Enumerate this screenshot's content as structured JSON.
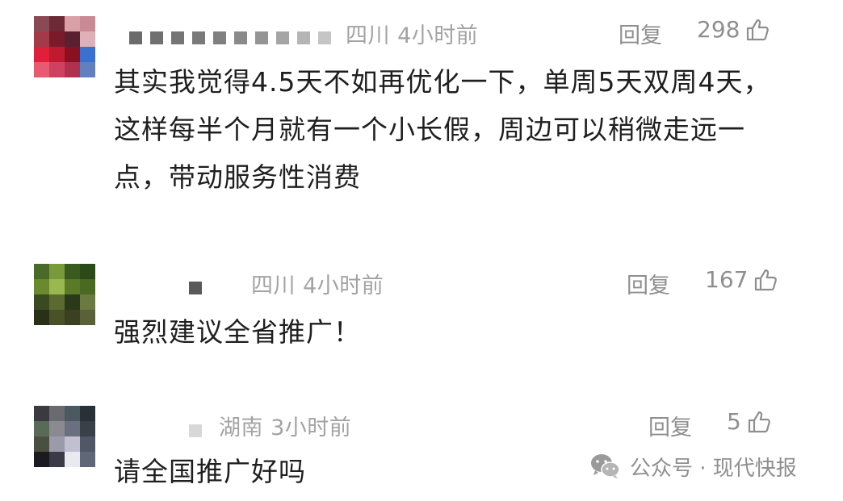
{
  "comments": [
    {
      "region": "四川",
      "time": "4小时前",
      "reply_label": "回复",
      "likes": "298",
      "text": "其实我觉得4.5天不如再优化一下，单周5天双周4天，这样每半个月就有一个小长假，周边可以稍微走远一点，带动服务性消费"
    },
    {
      "region": "四川",
      "time": "4小时前",
      "reply_label": "回复",
      "likes": "167",
      "text": "强烈建议全省推广！"
    },
    {
      "region": "湖南",
      "time": "3小时前",
      "reply_label": "回复",
      "likes": "5",
      "text": "请全国推广好吗"
    }
  ],
  "watermark": {
    "source": "公众号 · 现代快报",
    "icon": "wechat-icon"
  },
  "colors": {
    "text": "#1f1f1f",
    "meta": "#a3a3a3",
    "action": "#8f8f8f"
  }
}
